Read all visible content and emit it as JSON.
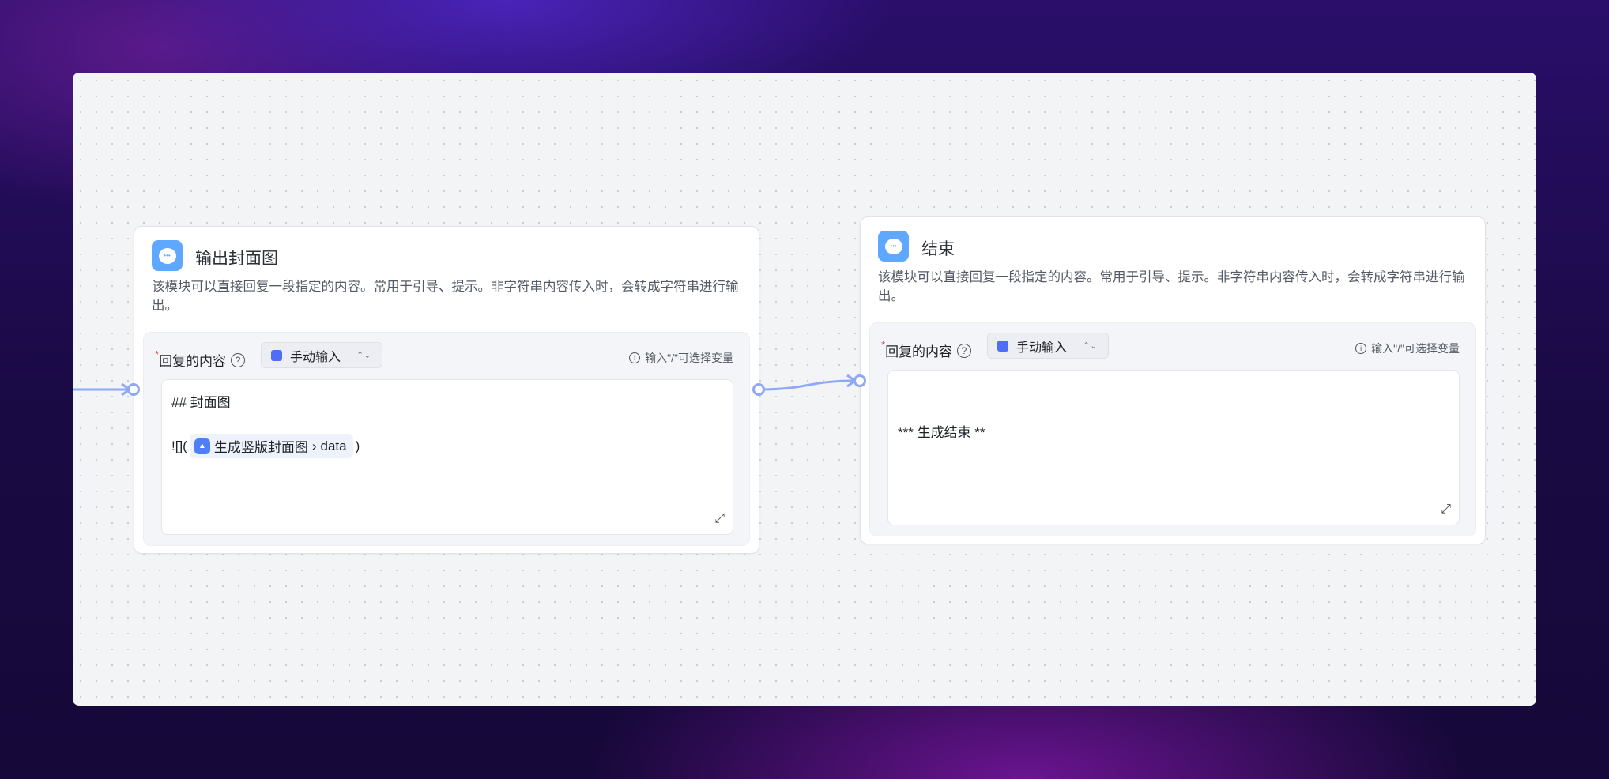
{
  "nodes": [
    {
      "title": "输出封面图",
      "description": "该模块可以直接回复一段指定的内容。常用于引导、提示。非字符串内容传入时，会转成字符串进行输出。",
      "field_label": "回复的内容",
      "required_mark": "*",
      "help": "?",
      "mode": "手动输入",
      "hint": "输入\"/\"可选择变量",
      "content_line1": "## 封面图",
      "content_prefix": "![](",
      "variable_node": "生成竖版封面图",
      "variable_sep": "›",
      "variable_field": "data",
      "content_suffix": ")"
    },
    {
      "title": "结束",
      "description": "该模块可以直接回复一段指定的内容。常用于引导、提示。非字符串内容传入时，会转成字符串进行输出。",
      "field_label": "回复的内容",
      "required_mark": "*",
      "help": "?",
      "mode": "手动输入",
      "hint": "输入\"/\"可选择变量",
      "content": "*** 生成结束 **"
    }
  ],
  "colors": {
    "accent": "#5ea8ff",
    "edge": "#8fa8f5",
    "required": "#e5484d"
  }
}
